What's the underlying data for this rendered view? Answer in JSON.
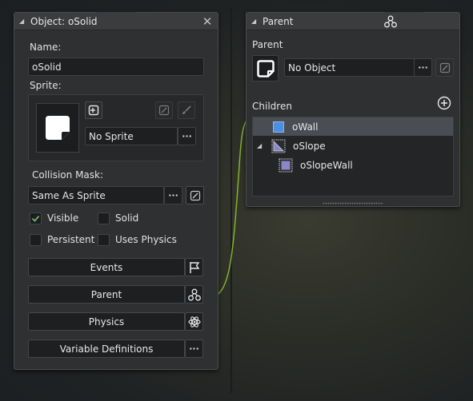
{
  "object_window": {
    "title": "Object: oSolid",
    "name_label": "Name:",
    "name_value": "oSolid",
    "sprite_label": "Sprite:",
    "sprite_value": "No Sprite",
    "collision_label": "Collision Mask:",
    "collision_value": "Same As Sprite",
    "checkboxes": [
      {
        "label": "Visible",
        "checked": true
      },
      {
        "label": "Solid",
        "checked": false
      },
      {
        "label": "Persistent",
        "checked": false
      },
      {
        "label": "Uses Physics",
        "checked": false
      }
    ],
    "buttons": {
      "events": "Events",
      "parent": "Parent",
      "physics": "Physics",
      "variable_definitions": "Variable Definitions"
    }
  },
  "parent_window": {
    "title": "Parent",
    "parent_label": "Parent",
    "parent_value": "No Object",
    "children_label": "Children",
    "children": [
      {
        "name": "oWall",
        "selected": true
      },
      {
        "name": "oSlope",
        "expanded": true
      },
      {
        "name": "oSlopeWall"
      }
    ]
  },
  "ellipsis": "···",
  "close_glyph": "✕",
  "collapse_glyph": "◢",
  "colors": {
    "accent_green": "#8fbf2f",
    "checkmark": "#6fb36a",
    "tree_selected": "#4a4e54",
    "child_icon_blue": "#4a90e2"
  }
}
